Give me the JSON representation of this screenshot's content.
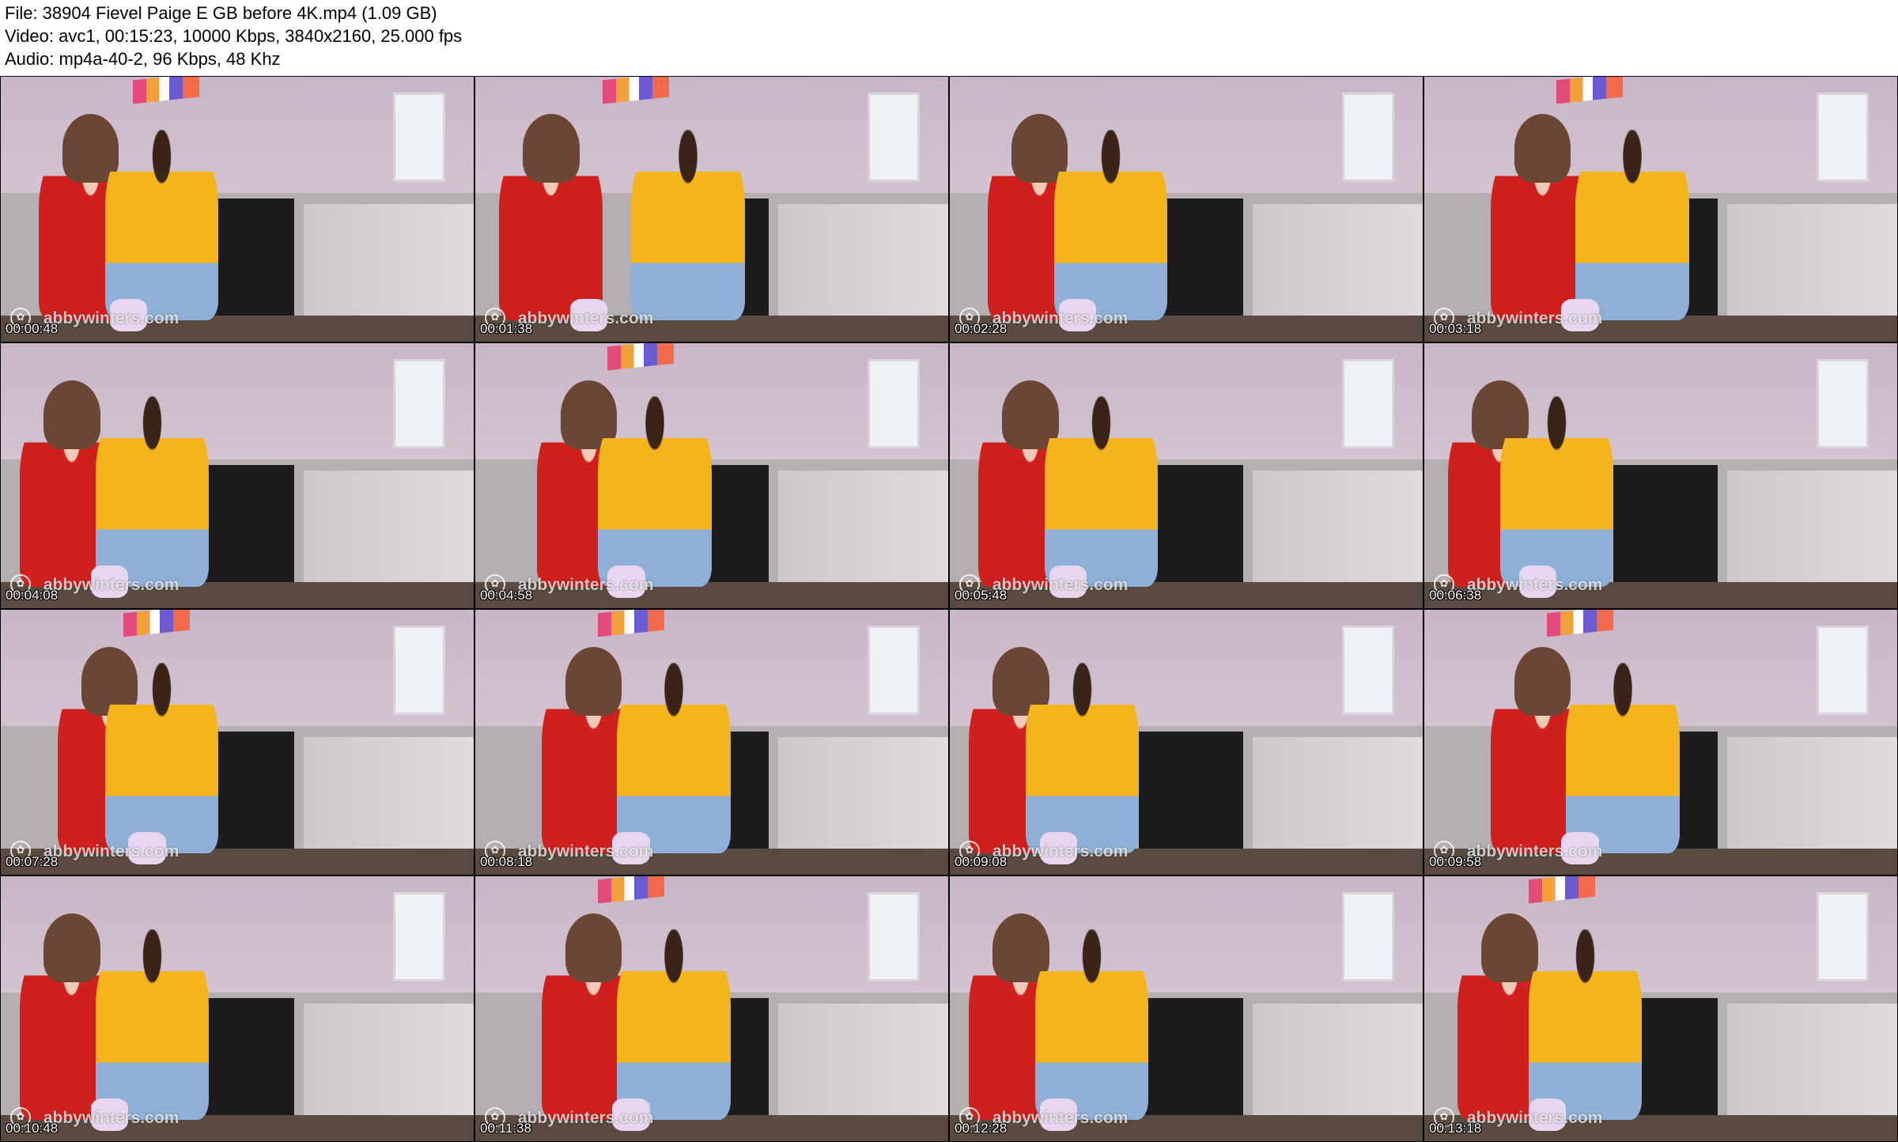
{
  "header": {
    "file_line": "File: 38904 Fievel Paige E GB before 4K.mp4 (1.09 GB)",
    "video_line": "Video: avc1, 00:15:23, 10000 Kbps, 3840x2160, 25.000 fps",
    "audio_line": "Audio: mp4a-40-2, 96 Kbps, 48 Khz"
  },
  "watermark_text": "abbywinters.com",
  "logo_icon": "leaf-logo-icon",
  "colors": {
    "dress": "#d0201e",
    "sweater": "#f4b51c",
    "wall": "#c8b6c8"
  },
  "thumbnails": [
    {
      "timestamp": "00:00:48"
    },
    {
      "timestamp": "00:01:38"
    },
    {
      "timestamp": "00:02:28"
    },
    {
      "timestamp": "00:03:18"
    },
    {
      "timestamp": "00:04:08"
    },
    {
      "timestamp": "00:04:58"
    },
    {
      "timestamp": "00:05:48"
    },
    {
      "timestamp": "00:06:38"
    },
    {
      "timestamp": "00:07:28"
    },
    {
      "timestamp": "00:08:18"
    },
    {
      "timestamp": "00:09:08"
    },
    {
      "timestamp": "00:09:58"
    },
    {
      "timestamp": "00:10:48"
    },
    {
      "timestamp": "00:11:38"
    },
    {
      "timestamp": "00:12:28"
    },
    {
      "timestamp": "00:13:18"
    }
  ]
}
